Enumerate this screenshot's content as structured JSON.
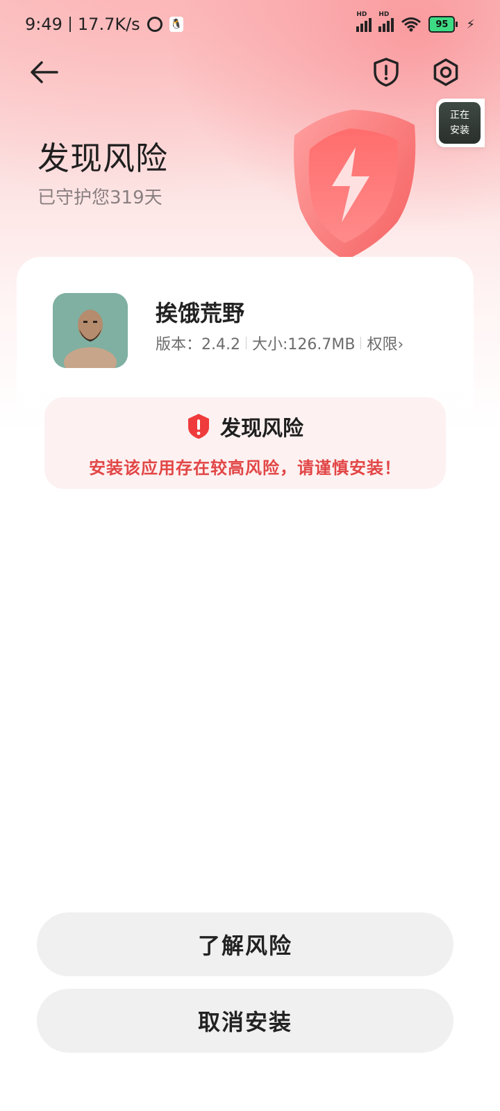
{
  "status_bar": {
    "time": "9:49",
    "speed": "17.7K/s",
    "battery": "95",
    "hd1": "HD",
    "hd2": "HD"
  },
  "floating_chip": {
    "line1": "正在",
    "line2": "安装"
  },
  "hero": {
    "title": "发现风险",
    "subtitle": "已守护您319天"
  },
  "app": {
    "name": "挨饿荒野",
    "version_text": "版本：2.4.2",
    "size_text": "大小:126.7MB",
    "permissions_label": "权限",
    "chevron": "›"
  },
  "risk": {
    "title": "发现风险",
    "description": "安装该应用存在较高风险，请谨慎安装！"
  },
  "buttons": {
    "learn_risk": "了解风险",
    "cancel_install": "取消安装"
  },
  "colors": {
    "accent_red": "#e24646",
    "shield_red": "#ef3b3b",
    "button_bg": "#f0f0f0",
    "battery_green": "#3ddc84"
  },
  "icons": [
    "back-arrow-icon",
    "shield-alert-icon",
    "settings-icon",
    "warning-shield-icon",
    "alarm-icon",
    "qq-icon",
    "signal-icon",
    "wifi-icon",
    "battery-icon",
    "charging-icon"
  ]
}
